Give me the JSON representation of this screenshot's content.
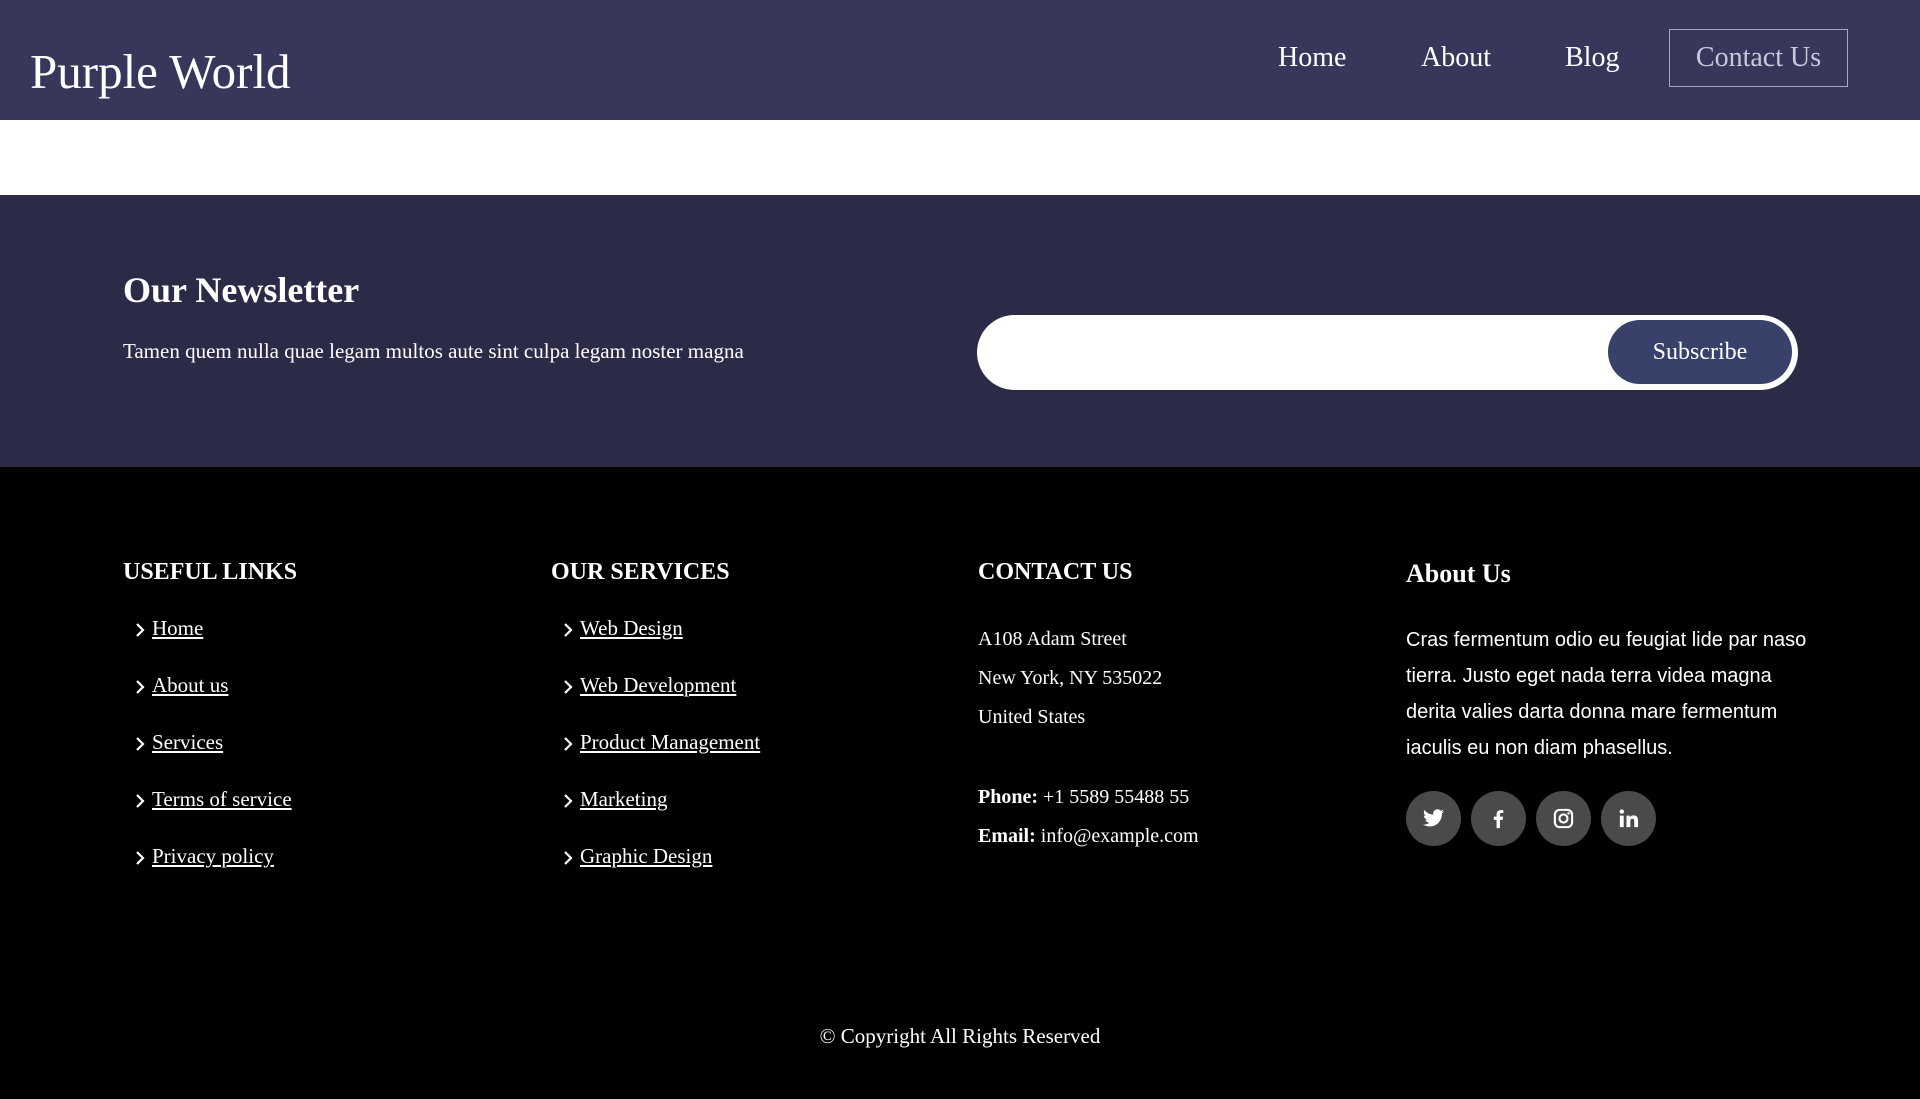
{
  "header": {
    "logo": "Purple World",
    "nav": {
      "home": "Home",
      "about": "About",
      "blog": "Blog",
      "contact": "Contact Us"
    }
  },
  "newsletter": {
    "title": "Our Newsletter",
    "text": "Tamen quem nulla quae legam multos aute sint culpa legam noster magna",
    "input_value": "",
    "button": "Subscribe"
  },
  "footer": {
    "useful_links": {
      "title": "USEFUL LINKS",
      "items": [
        "Home",
        "About us",
        "Services",
        "Terms of service",
        "Privacy policy"
      ]
    },
    "services": {
      "title": "OUR SERVICES",
      "items": [
        "Web Design",
        "Web Development",
        "Product Management",
        "Marketing",
        "Graphic Design"
      ]
    },
    "contact": {
      "title": "CONTACT US",
      "address": [
        "A108 Adam Street",
        "New York, NY 535022",
        "United States"
      ],
      "phone_label": "Phone:",
      "phone": "+1 5589 55488 55",
      "email_label": "Email:",
      "email": "info@example.com"
    },
    "about": {
      "title": "About Us",
      "text": "Cras fermentum odio eu feugiat lide par naso tierra. Justo eget nada terra videa magna derita valies darta donna mare fermentum iaculis eu non diam phasellus.",
      "socials": [
        "twitter-icon",
        "facebook-icon",
        "instagram-icon",
        "linkedin-icon"
      ]
    },
    "copyright": "© Copyright All Rights Reserved"
  },
  "colors": {
    "header_bg": "#37375c",
    "newsletter_bg": "#2b2b48",
    "footer_bg": "#000000",
    "subscribe_bg": "#37416a",
    "social_bg": "#4a4a4a"
  }
}
